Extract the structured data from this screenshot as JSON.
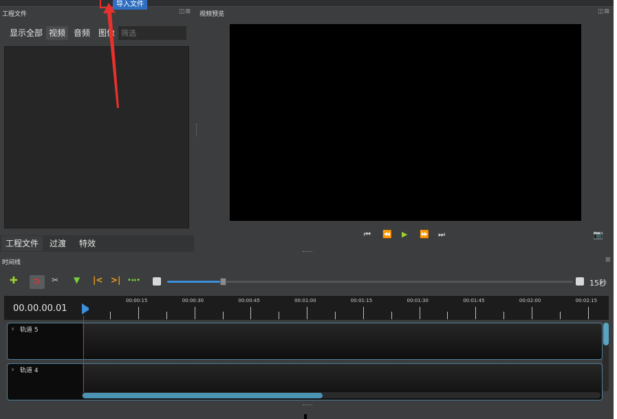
{
  "tooltip": {
    "text": "导入文件"
  },
  "project_panel": {
    "title": "工程文件",
    "dock_icons": "◫⊠",
    "filters": [
      "显示全部",
      "视频",
      "音频",
      "图像"
    ],
    "active_filter": "视频",
    "filter_placeholder": "筛选",
    "tabs": [
      "工程文件",
      "过渡",
      "特效"
    ]
  },
  "preview_panel": {
    "title": "视频预览",
    "dock_icons": "◫⊠",
    "controls": {
      "jump_start": "⏮",
      "rewind": "⏪",
      "play": "▶",
      "fast_forward": "⏩",
      "jump_end": "⏭",
      "camera": "📷"
    }
  },
  "timeline": {
    "title": "时间线",
    "dock_icons": "⊠",
    "tools": {
      "add": "✚",
      "snap": "⊃",
      "razor": "✂",
      "marker": "▼",
      "prev_marker": "|<",
      "next_marker": ">|",
      "center": "•↔•"
    },
    "zoom_label": "15秒",
    "timecode": "00.00.00.01",
    "ruler_labels": [
      "00:00:15",
      "00:00:30",
      "00:00:45",
      "00:01:00",
      "00:01:15",
      "00:01:30",
      "00:01:45",
      "00:02:00",
      "00:02:15"
    ],
    "tracks": [
      "轨道 5",
      "轨道 4"
    ]
  },
  "colors": {
    "accent": "#3b8ed9",
    "play": "#9bd22f",
    "annotation": "#e8312d",
    "track_border": "#4f7f9a"
  }
}
